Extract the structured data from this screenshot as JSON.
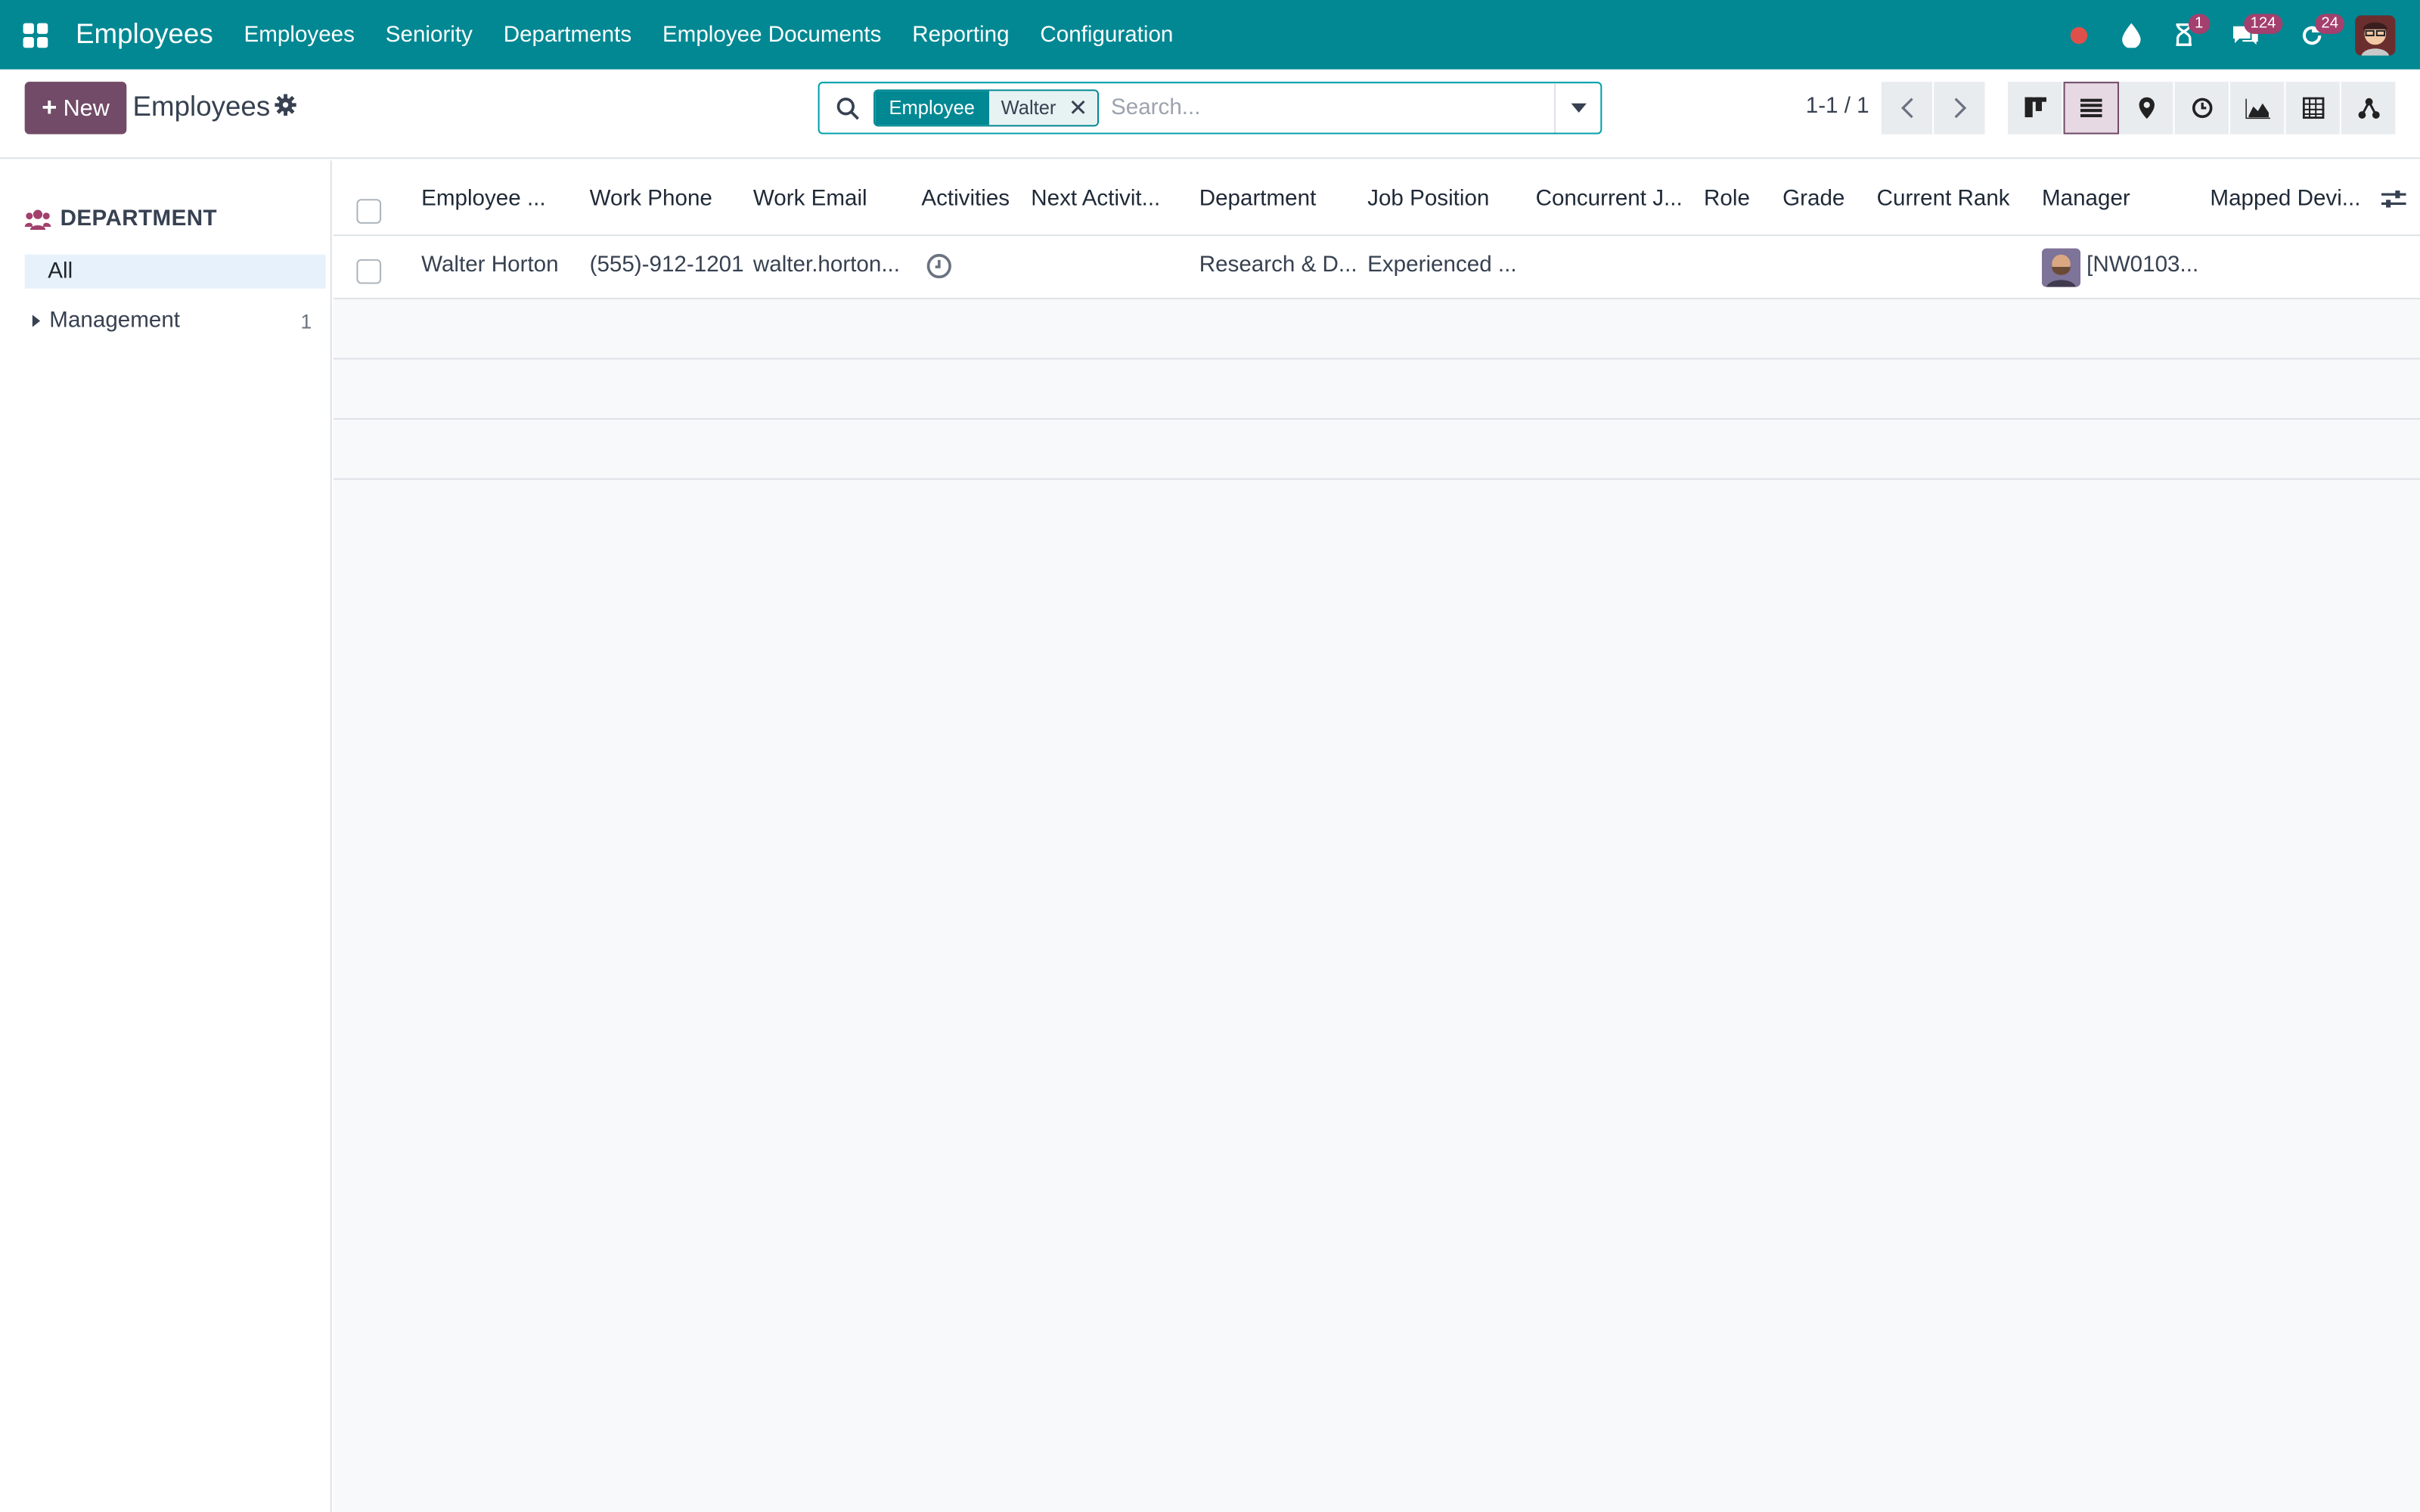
{
  "navbar": {
    "brand": "Employees",
    "menu": [
      "Employees",
      "Seniority",
      "Departments",
      "Employee Documents",
      "Reporting",
      "Configuration"
    ],
    "badges": {
      "activities": "1",
      "messages": "124",
      "updates": "24"
    },
    "color": "#018893"
  },
  "control": {
    "new_label": "New",
    "title": "Employees",
    "search": {
      "facet_label": "Employee",
      "facet_value": "Walter",
      "placeholder": "Search..."
    },
    "pager": "1-1 / 1"
  },
  "sidebar": {
    "title": "DEPARTMENT",
    "all_label": "All",
    "items": [
      {
        "label": "Management",
        "count": "1"
      }
    ]
  },
  "table": {
    "columns": [
      "Employee ...",
      "Work Phone",
      "Work Email",
      "Activities",
      "Next Activit...",
      "Department",
      "Job Position",
      "Concurrent J...",
      "Role",
      "Grade",
      "Current Rank",
      "Manager",
      "Mapped Devi..."
    ],
    "rows": [
      {
        "name": "Walter Horton",
        "phone": "(555)-912-1201",
        "email": "walter.horton...",
        "next_activity": "",
        "department": "Research & D...",
        "job_position": "Experienced ...",
        "manager": "[NW0103..."
      }
    ]
  },
  "colors": {
    "primary": "#714b67",
    "teal": "#018893",
    "badge": "#a3406d"
  }
}
